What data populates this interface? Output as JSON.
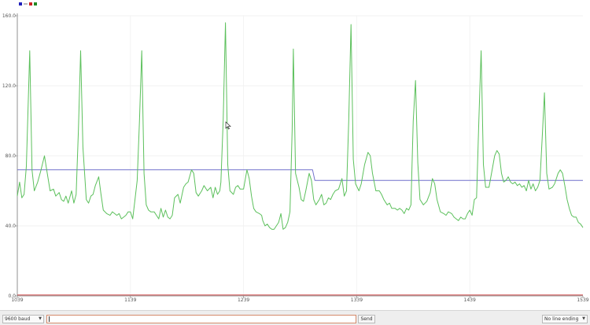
{
  "bottom_bar": {
    "baud": "9600 baud",
    "input_value": "",
    "send_label": "Send",
    "line_ending": "No line ending"
  },
  "chart_data": {
    "type": "line",
    "xlim": [
      1039,
      1539
    ],
    "ylim": [
      0,
      160
    ],
    "x_ticks": [
      "1039",
      "1139",
      "1239",
      "1339",
      "1439",
      "1539"
    ],
    "y_ticks": [
      "0.0",
      "40.0",
      "80.0",
      "120.0",
      "160.0"
    ],
    "grid": true,
    "legend": {
      "placement": "top-left",
      "colors": [
        "#2222bb",
        "#cc2222",
        "#228822"
      ],
      "text": "....."
    },
    "series": [
      {
        "color": "#7070cc",
        "points": [
          [
            1039,
            72
          ],
          [
            1300,
            72
          ],
          [
            1302,
            66
          ],
          [
            1539,
            66
          ]
        ]
      },
      {
        "color": "#cc4444",
        "points": [
          [
            1039,
            0.5
          ],
          [
            1539,
            0.5
          ]
        ]
      },
      {
        "color": "#5cc05c",
        "points": [
          [
            1039,
            57
          ],
          [
            1041,
            65
          ],
          [
            1043,
            56
          ],
          [
            1045,
            58
          ],
          [
            1047,
            74
          ],
          [
            1050,
            140
          ],
          [
            1052,
            72
          ],
          [
            1054,
            60
          ],
          [
            1057,
            65
          ],
          [
            1060,
            72
          ],
          [
            1063,
            80
          ],
          [
            1066,
            68
          ],
          [
            1068,
            60
          ],
          [
            1071,
            61
          ],
          [
            1073,
            57
          ],
          [
            1076,
            59
          ],
          [
            1078,
            55
          ],
          [
            1080,
            54
          ],
          [
            1082,
            57
          ],
          [
            1084,
            53
          ],
          [
            1087,
            60
          ],
          [
            1089,
            53
          ],
          [
            1091,
            58
          ],
          [
            1093,
            95
          ],
          [
            1095,
            140
          ],
          [
            1097,
            85
          ],
          [
            1100,
            55
          ],
          [
            1102,
            53
          ],
          [
            1104,
            57
          ],
          [
            1106,
            58
          ],
          [
            1108,
            63
          ],
          [
            1111,
            68
          ],
          [
            1113,
            58
          ],
          [
            1115,
            49
          ],
          [
            1118,
            47
          ],
          [
            1121,
            46
          ],
          [
            1123,
            48
          ],
          [
            1125,
            47
          ],
          [
            1127,
            46
          ],
          [
            1129,
            47
          ],
          [
            1131,
            44
          ],
          [
            1133,
            45
          ],
          [
            1135,
            46
          ],
          [
            1137,
            48
          ],
          [
            1139,
            48
          ],
          [
            1141,
            44
          ],
          [
            1143,
            55
          ],
          [
            1145,
            66
          ],
          [
            1147,
            100
          ],
          [
            1149,
            140
          ],
          [
            1151,
            70
          ],
          [
            1153,
            52
          ],
          [
            1155,
            49
          ],
          [
            1157,
            48
          ],
          [
            1160,
            48
          ],
          [
            1162,
            46
          ],
          [
            1164,
            44
          ],
          [
            1166,
            50
          ],
          [
            1168,
            45
          ],
          [
            1170,
            49
          ],
          [
            1172,
            45
          ],
          [
            1174,
            44
          ],
          [
            1176,
            46
          ],
          [
            1178,
            56
          ],
          [
            1181,
            58
          ],
          [
            1183,
            53
          ],
          [
            1186,
            62
          ],
          [
            1188,
            64
          ],
          [
            1190,
            65
          ],
          [
            1193,
            72
          ],
          [
            1195,
            70
          ],
          [
            1197,
            59
          ],
          [
            1199,
            57
          ],
          [
            1202,
            60
          ],
          [
            1204,
            63
          ],
          [
            1207,
            60
          ],
          [
            1210,
            62
          ],
          [
            1212,
            56
          ],
          [
            1214,
            62
          ],
          [
            1216,
            58
          ],
          [
            1218,
            60
          ],
          [
            1219,
            65
          ],
          [
            1221,
            100
          ],
          [
            1223,
            156
          ],
          [
            1225,
            75
          ],
          [
            1227,
            60
          ],
          [
            1230,
            58
          ],
          [
            1232,
            62
          ],
          [
            1234,
            63
          ],
          [
            1236,
            61
          ],
          [
            1239,
            61
          ],
          [
            1242,
            72
          ],
          [
            1244,
            67
          ],
          [
            1246,
            57
          ],
          [
            1248,
            50
          ],
          [
            1250,
            48
          ],
          [
            1253,
            47
          ],
          [
            1255,
            46
          ],
          [
            1256,
            43
          ],
          [
            1258,
            40
          ],
          [
            1260,
            41
          ],
          [
            1262,
            39
          ],
          [
            1264,
            38
          ],
          [
            1266,
            38
          ],
          [
            1268,
            40
          ],
          [
            1270,
            42
          ],
          [
            1272,
            47
          ],
          [
            1274,
            38
          ],
          [
            1276,
            39
          ],
          [
            1278,
            42
          ],
          [
            1280,
            48
          ],
          [
            1282,
            95
          ],
          [
            1283,
            141
          ],
          [
            1285,
            70
          ],
          [
            1288,
            62
          ],
          [
            1290,
            55
          ],
          [
            1292,
            54
          ],
          [
            1294,
            60
          ],
          [
            1297,
            70
          ],
          [
            1299,
            66
          ],
          [
            1301,
            55
          ],
          [
            1303,
            52
          ],
          [
            1306,
            55
          ],
          [
            1308,
            58
          ],
          [
            1310,
            52
          ],
          [
            1312,
            53
          ],
          [
            1314,
            56
          ],
          [
            1316,
            55
          ],
          [
            1318,
            58
          ],
          [
            1320,
            60
          ],
          [
            1323,
            61
          ],
          [
            1326,
            67
          ],
          [
            1328,
            57
          ],
          [
            1330,
            60
          ],
          [
            1332,
            100
          ],
          [
            1334,
            155
          ],
          [
            1336,
            78
          ],
          [
            1338,
            64
          ],
          [
            1341,
            60
          ],
          [
            1343,
            64
          ],
          [
            1346,
            75
          ],
          [
            1349,
            82
          ],
          [
            1351,
            80
          ],
          [
            1353,
            70
          ],
          [
            1356,
            60
          ],
          [
            1359,
            60
          ],
          [
            1361,
            58
          ],
          [
            1363,
            55
          ],
          [
            1366,
            52
          ],
          [
            1368,
            53
          ],
          [
            1370,
            50
          ],
          [
            1373,
            50
          ],
          [
            1375,
            49
          ],
          [
            1377,
            50
          ],
          [
            1379,
            49
          ],
          [
            1381,
            47
          ],
          [
            1383,
            50
          ],
          [
            1385,
            49
          ],
          [
            1387,
            52
          ],
          [
            1389,
            100
          ],
          [
            1391,
            123
          ],
          [
            1393,
            76
          ],
          [
            1395,
            55
          ],
          [
            1398,
            52
          ],
          [
            1401,
            54
          ],
          [
            1404,
            59
          ],
          [
            1406,
            67
          ],
          [
            1408,
            64
          ],
          [
            1410,
            55
          ],
          [
            1413,
            48
          ],
          [
            1416,
            47
          ],
          [
            1418,
            46
          ],
          [
            1420,
            48
          ],
          [
            1423,
            47
          ],
          [
            1425,
            45
          ],
          [
            1427,
            44
          ],
          [
            1429,
            43
          ],
          [
            1431,
            45
          ],
          [
            1433,
            44
          ],
          [
            1435,
            44
          ],
          [
            1437,
            47
          ],
          [
            1439,
            49
          ],
          [
            1441,
            46
          ],
          [
            1443,
            55
          ],
          [
            1445,
            56
          ],
          [
            1447,
            100
          ],
          [
            1449,
            140
          ],
          [
            1451,
            75
          ],
          [
            1453,
            62
          ],
          [
            1456,
            62
          ],
          [
            1459,
            73
          ],
          [
            1461,
            80
          ],
          [
            1463,
            83
          ],
          [
            1465,
            81
          ],
          [
            1467,
            70
          ],
          [
            1469,
            65
          ],
          [
            1471,
            66
          ],
          [
            1473,
            68
          ],
          [
            1475,
            65
          ],
          [
            1477,
            64
          ],
          [
            1479,
            65
          ],
          [
            1481,
            63
          ],
          [
            1483,
            64
          ],
          [
            1485,
            62
          ],
          [
            1487,
            63
          ],
          [
            1489,
            60
          ],
          [
            1491,
            66
          ],
          [
            1493,
            61
          ],
          [
            1495,
            64
          ],
          [
            1497,
            60
          ],
          [
            1499,
            62
          ],
          [
            1501,
            66
          ],
          [
            1503,
            90
          ],
          [
            1505,
            116
          ],
          [
            1507,
            70
          ],
          [
            1509,
            61
          ],
          [
            1512,
            62
          ],
          [
            1514,
            64
          ],
          [
            1517,
            70
          ],
          [
            1519,
            72
          ],
          [
            1521,
            70
          ],
          [
            1523,
            63
          ],
          [
            1525,
            55
          ],
          [
            1527,
            50
          ],
          [
            1529,
            46
          ],
          [
            1531,
            45
          ],
          [
            1533,
            45
          ],
          [
            1535,
            42
          ],
          [
            1537,
            41
          ],
          [
            1539,
            39
          ]
        ]
      }
    ]
  }
}
